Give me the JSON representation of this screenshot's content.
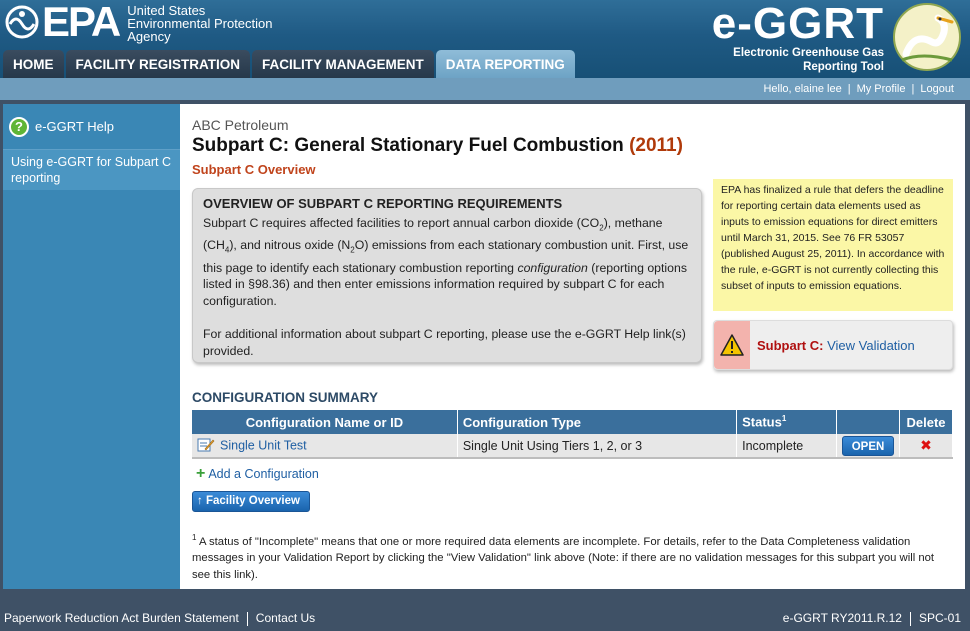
{
  "header": {
    "epa_wordmark": "EPA",
    "agency_lines": [
      "United States",
      "Environmental Protection",
      "Agency"
    ],
    "brand": "e-GGRT",
    "brand_sub_lines": [
      "Electronic Greenhouse Gas",
      "Reporting Tool"
    ]
  },
  "nav": {
    "tabs": [
      {
        "label": "HOME",
        "active": false
      },
      {
        "label": "FACILITY REGISTRATION",
        "active": false
      },
      {
        "label": "FACILITY MANAGEMENT",
        "active": false
      },
      {
        "label": "DATA REPORTING",
        "active": true
      }
    ]
  },
  "userbar": {
    "greeting": "Hello, elaine lee",
    "my_profile": "My Profile",
    "logout": "Logout"
  },
  "sidebar": {
    "help_label": "e-GGRT Help",
    "help_link": "Using e-GGRT for Subpart C reporting"
  },
  "main": {
    "org_name": "ABC Petroleum",
    "title": "Subpart C: General Stationary Fuel Combustion",
    "title_year": "(2011)",
    "subtitle": "Subpart C Overview",
    "overview": {
      "heading": "OVERVIEW OF SUBPART C REPORTING REQUIREMENTS",
      "para1_a": "Subpart C requires affected facilities to report annual carbon dioxide (CO",
      "para1_b": "), methane (CH",
      "para1_c": "), and nitrous oxide (N",
      "para1_d": "O) emissions from each stationary combustion unit. First, use this page to identify each stationary combustion reporting ",
      "para1_em": "configuration",
      "para1_e": " (reporting options listed in §98.36) and then enter emissions information required by subpart C for each configuration.",
      "para2": "For additional information about subpart C reporting, please use the e-GGRT Help link(s) provided."
    },
    "rule_notice": "EPA has finalized a rule that defers the deadline for reporting certain data elements used as inputs to emission equations for direct emitters until March 31, 2015. See 76 FR 53057 (published August 25, 2011). In accordance with the rule, e-GGRT is not currently collecting this subset of inputs to emission equations.",
    "validation": {
      "label": "Subpart C:",
      "link": "View Validation"
    },
    "config_heading": "CONFIGURATION SUMMARY",
    "table": {
      "headers": [
        "Configuration Name or ID",
        "Configuration Type",
        "Status",
        "",
        "Delete"
      ],
      "status_sup": "1",
      "rows": [
        {
          "name": "Single Unit Test",
          "type": "Single Unit Using Tiers 1, 2, or 3",
          "status": "Incomplete",
          "action": "OPEN"
        }
      ]
    },
    "add_config": "Add a Configuration",
    "facility_overview_btn": "Facility Overview",
    "footnote_sup": "1",
    "footnote": " A status of \"Incomplete\" means that one or more required data elements are incomplete. For details, refer to the Data Completeness validation messages in your Validation Report by clicking the \"View Validation\" link above (Note: if there are no validation messages for this subpart you will not see this link)."
  },
  "footer": {
    "burden": "Paperwork Reduction Act Burden Statement",
    "contact": "Contact Us",
    "version": "e-GGRT RY2011.R.12",
    "page_id": "SPC-01"
  },
  "colors": {
    "header_blue": "#1f5a84",
    "sidebar_blue": "#3a87b5",
    "table_header": "#3a6f9c",
    "title_accent": "#b03a0a",
    "notice_yellow": "#fbf7a6"
  }
}
